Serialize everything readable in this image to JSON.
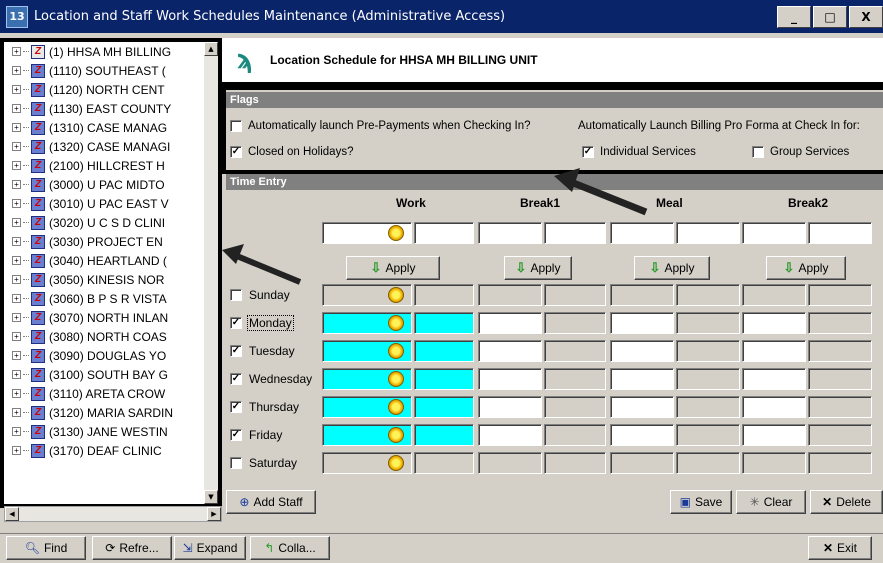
{
  "window": {
    "title": "Location and Staff Work Schedules Maintenance (Administrative Access)",
    "minimize": "_",
    "maximize": "□",
    "close": "X"
  },
  "tree": {
    "items": [
      {
        "label": "(1) HHSA MH BILLING",
        "icon": "red"
      },
      {
        "label": "(1110) SOUTHEAST (",
        "icon": "blue"
      },
      {
        "label": "(1120) NORTH CENT",
        "icon": "blue"
      },
      {
        "label": "(1130) EAST COUNTY",
        "icon": "blue"
      },
      {
        "label": "(1310) CASE MANAG",
        "icon": "blue"
      },
      {
        "label": "(1320) CASE MANAGI",
        "icon": "blue"
      },
      {
        "label": "(2100) HILLCREST H",
        "icon": "blue"
      },
      {
        "label": "(3000) U PAC MIDTO",
        "icon": "blue"
      },
      {
        "label": "(3010) U PAC EAST V",
        "icon": "blue"
      },
      {
        "label": "(3020) U C S D CLINI",
        "icon": "blue"
      },
      {
        "label": "(3030) PROJECT EN",
        "icon": "blue"
      },
      {
        "label": "(3040) HEARTLAND (",
        "icon": "blue"
      },
      {
        "label": "(3050) KINESIS NOR",
        "icon": "blue"
      },
      {
        "label": "(3060) B P S R VISTA",
        "icon": "blue"
      },
      {
        "label": "(3070) NORTH INLAN",
        "icon": "blue"
      },
      {
        "label": "(3080) NORTH COAS",
        "icon": "blue"
      },
      {
        "label": "(3090) DOUGLAS YO",
        "icon": "blue"
      },
      {
        "label": "(3100) SOUTH BAY G",
        "icon": "blue"
      },
      {
        "label": "(3110) ARETA CROW",
        "icon": "blue"
      },
      {
        "label": "(3120) MARIA SARDIN",
        "icon": "blue"
      },
      {
        "label": "(3130) JANE WESTIN",
        "icon": "blue"
      },
      {
        "label": "(3170) DEAF CLINIC",
        "icon": "blue"
      }
    ]
  },
  "header": {
    "title": "Location Schedule for HHSA MH BILLING UNIT"
  },
  "flags": {
    "section_label": "Flags",
    "auto_prepayments": {
      "label": "Automatically launch Pre-Payments when Checking In?",
      "checked": false
    },
    "auto_billing_label": "Automatically Launch Billing Pro Forma at Check In for:",
    "closed_holidays": {
      "label": "Closed on Holidays?",
      "checked": true
    },
    "individual_services": {
      "label": "Individual Services",
      "checked": true
    },
    "group_services": {
      "label": "Group Services",
      "checked": false
    }
  },
  "time_entry": {
    "section_label": "Time Entry",
    "columns": [
      "Work",
      "Break1",
      "Meal",
      "Break2"
    ],
    "apply_label": "Apply",
    "days": [
      {
        "label": "Sunday",
        "checked": false
      },
      {
        "label": "Monday",
        "checked": true
      },
      {
        "label": "Tuesday",
        "checked": true
      },
      {
        "label": "Wednesday",
        "checked": true
      },
      {
        "label": "Thursday",
        "checked": true
      },
      {
        "label": "Friday",
        "checked": true
      },
      {
        "label": "Saturday",
        "checked": false
      }
    ],
    "colors": {
      "work_active": "#00ffff"
    }
  },
  "actions": {
    "add_staff": "Add Staff",
    "save": "Save",
    "clear": "Clear",
    "delete": "Delete"
  },
  "bottom": {
    "find": "Find",
    "refresh": "Refre...",
    "expand": "Expand",
    "collapse": "Colla...",
    "exit": "Exit"
  }
}
